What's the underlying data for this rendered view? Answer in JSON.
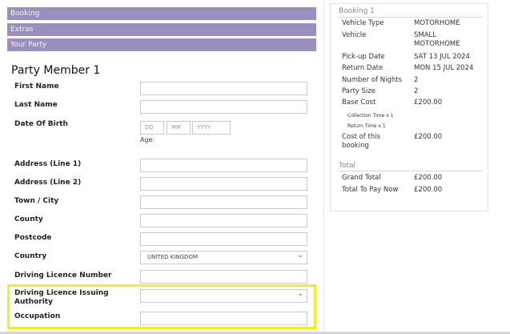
{
  "accordion": {
    "booking": "Booking",
    "extras": "Extras",
    "your_party": "Your Party"
  },
  "form": {
    "title": "Party Member 1",
    "first_name": "First Name",
    "last_name": "Last Name",
    "dob": "Date Of Birth",
    "dd_placeholder": "DD",
    "mm_placeholder": "MM",
    "yyyy_placeholder": "YYYY",
    "age": "Age:",
    "address1": "Address (Line 1)",
    "address2": "Address (Line 2)",
    "town": "Town / City",
    "county": "County",
    "postcode": "Postcode",
    "country": "Country",
    "country_value": "UNITED KINGDOM",
    "licence_number": "Driving Licence Number",
    "licence_authority": "Driving Licence Issuing Authority",
    "occupation": "Occupation"
  },
  "summary": {
    "booking_title": "Booking 1",
    "vehicle_type_label": "Vehicle Type",
    "vehicle_type": "MOTORHOME",
    "vehicle_label": "Vehicle",
    "vehicle": "SMALL MOTORHOME",
    "pickup_label": "Pick-up Date",
    "pickup": "SAT 13 JUL 2024",
    "return_label": "Return Date",
    "return": "MON 15 JUL 2024",
    "nights_label": "Number of Nights",
    "nights": "2",
    "party_label": "Party Size",
    "party": "2",
    "base_label": "Base Cost",
    "base": "£200.00",
    "collection_time": "Collection Time x 1",
    "return_time": "Return Time x 1",
    "cost_label": "Cost of this booking",
    "cost": "£200.00",
    "total_title": "Total",
    "grand_label": "Grand Total",
    "grand": "£200.00",
    "pay_label": "Total To Pay Now",
    "pay": "£200.00"
  }
}
